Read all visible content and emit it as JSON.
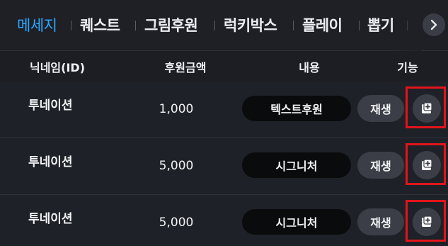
{
  "tabs": [
    {
      "label": "메세지",
      "active": true
    },
    {
      "label": "퀘스트",
      "active": false
    },
    {
      "label": "그림후원",
      "active": false
    },
    {
      "label": "럭키박스",
      "active": false
    },
    {
      "label": "플레이",
      "active": false
    },
    {
      "label": "뽑기",
      "active": false
    }
  ],
  "tab_scroll_icon": "chevron-right-icon",
  "table": {
    "headers": {
      "nickname": "닉네임(ID)",
      "amount": "후원금액",
      "content": "내용",
      "function": "기능"
    },
    "rows": [
      {
        "nickname": "투네이션",
        "amount": "1,000",
        "content": "텍스트후원",
        "play_label": "재생",
        "action_icon": "add-square-icon"
      },
      {
        "nickname": "투네이션",
        "amount": "5,000",
        "content": "시그니처",
        "play_label": "재생",
        "action_icon": "add-square-icon"
      },
      {
        "nickname": "투네이션",
        "amount": "5,000",
        "content": "시그니처",
        "play_label": "재생",
        "action_icon": "add-square-icon"
      }
    ]
  },
  "colors": {
    "active_tab": "#2ea8ff",
    "highlight": "#e2141b",
    "background": "#1c1e23"
  }
}
